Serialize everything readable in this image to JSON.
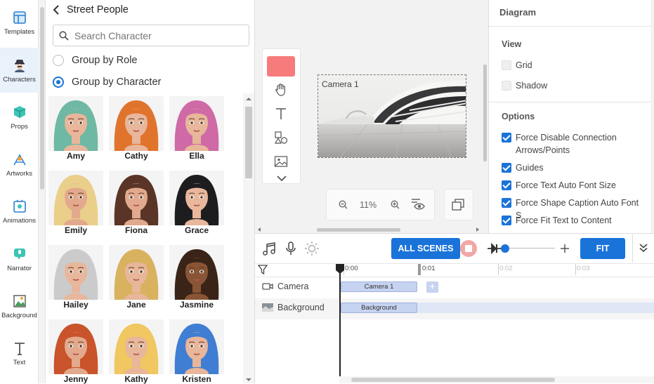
{
  "sidebar": {
    "items": [
      {
        "label": "Templates",
        "icon": "templates-icon"
      },
      {
        "label": "Characters",
        "icon": "characters-icon",
        "active": true
      },
      {
        "label": "Props",
        "icon": "props-icon"
      },
      {
        "label": "Artworks",
        "icon": "artworks-icon"
      },
      {
        "label": "Animations",
        "icon": "animations-icon"
      },
      {
        "label": "Narrator",
        "icon": "narrator-icon"
      },
      {
        "label": "Background",
        "icon": "background-icon"
      },
      {
        "label": "Text",
        "icon": "text-icon"
      }
    ]
  },
  "panel": {
    "back_title": "Street People",
    "search_placeholder": "Search Character",
    "group_by_role": "Group by Role",
    "group_by_character": "Group by Character",
    "selected_grouping": "Group by Character",
    "characters": [
      {
        "name": "Amy",
        "hair": "#6fb8a4",
        "skin": "#e8b69a"
      },
      {
        "name": "Cathy",
        "hair": "#e0742c",
        "skin": "#e8b69a"
      },
      {
        "name": "Ella",
        "hair": "#cf6aa6",
        "skin": "#e8b69a"
      },
      {
        "name": "Emily",
        "hair": "#e9cf8a",
        "skin": "#e3a98c"
      },
      {
        "name": "Fiona",
        "hair": "#5a3527",
        "skin": "#e1a98d"
      },
      {
        "name": "Grace",
        "hair": "#1d1d1f",
        "skin": "#e9b79c"
      },
      {
        "name": "Hailey",
        "hair": "#cbcbcb",
        "skin": "#e8b69a"
      },
      {
        "name": "Jane",
        "hair": "#d9b260",
        "skin": "#e8b69a"
      },
      {
        "name": "Jasmine",
        "hair": "#3a2418",
        "skin": "#8a5535"
      },
      {
        "name": "Jenny",
        "hair": "#c9532a",
        "skin": "#e3a98c"
      },
      {
        "name": "Kathy",
        "hair": "#f0c760",
        "skin": "#e8b69a"
      },
      {
        "name": "Kristen",
        "hair": "#3f7ed3",
        "skin": "#e8b69a"
      }
    ]
  },
  "canvas": {
    "camera_label": "Camera 1",
    "zoom": "11%",
    "shape_color": "#f77b7b"
  },
  "diagram": {
    "title": "Diagram",
    "view_heading": "View",
    "view_options": [
      {
        "label": "Grid",
        "checked": false
      },
      {
        "label": "Shadow",
        "checked": false
      }
    ],
    "options_heading": "Options",
    "options": [
      {
        "label": "Force Disable Connection Arrows/Points",
        "checked": true
      },
      {
        "label": "Guides",
        "checked": true
      },
      {
        "label": "Force Text Auto Font Size",
        "checked": true
      },
      {
        "label": "Force Shape Caption Auto Font S",
        "checked": true
      },
      {
        "label": "Force Fit Text to Content",
        "checked": true
      }
    ]
  },
  "timeline": {
    "all_scenes_label": "ALL SCENES",
    "fit_label": "FIT",
    "ruler": [
      "0:00",
      "0:01",
      "0:02",
      "0:03"
    ],
    "tracks": [
      {
        "label": "Camera",
        "clip": "Camera 1"
      },
      {
        "label": "Background",
        "clip": "Background"
      }
    ],
    "accent": "#1a73d9"
  }
}
